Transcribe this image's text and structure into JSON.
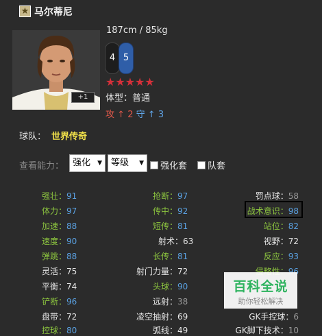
{
  "player": {
    "name": "马尔蒂尼",
    "size": "187cm / 85kg",
    "weak_foot_left": "4",
    "weak_foot_right": "5",
    "stars": "★★★★★",
    "body_type": "体型：普通",
    "card_plus": "+1",
    "workrate": {
      "atk_label": "攻",
      "atk_value": "2",
      "def_label": "守",
      "def_value": "3"
    }
  },
  "team": {
    "label": "球队：",
    "value": "世界传奇"
  },
  "filters": {
    "label": "查看能力：",
    "select1": "强化",
    "select2": "等级",
    "check1": "强化套",
    "check2": "队套"
  },
  "stats": {
    "col1": [
      {
        "label": "强壮：",
        "value": "91"
      },
      {
        "label": "体力：",
        "value": "97"
      },
      {
        "label": "加速：",
        "value": "88"
      },
      {
        "label": "速度：",
        "value": "90"
      },
      {
        "label": "弹跳：",
        "value": "88"
      },
      {
        "label": "灵活：",
        "value": "75"
      },
      {
        "label": "平衡：",
        "value": "74"
      },
      {
        "label": "铲断：",
        "value": "96"
      },
      {
        "label": "盘带：",
        "value": "72"
      },
      {
        "label": "控球：",
        "value": "80"
      }
    ],
    "col2": [
      {
        "label": "抢断：",
        "value": "97"
      },
      {
        "label": "传中：",
        "value": "92"
      },
      {
        "label": "短传：",
        "value": "81"
      },
      {
        "label": "射术：",
        "value": "63"
      },
      {
        "label": "长传：",
        "value": "81"
      },
      {
        "label": "射门力量：",
        "value": "72"
      },
      {
        "label": "头球：",
        "value": "90"
      },
      {
        "label": "远射：",
        "value": "38"
      },
      {
        "label": "凌空抽射：",
        "value": "69"
      },
      {
        "label": "弧线：",
        "value": "49"
      }
    ],
    "col3": [
      {
        "label": "罚点球：",
        "value": "58"
      },
      {
        "label": "战术意识：",
        "value": "98"
      },
      {
        "label": "站位：",
        "value": "82"
      },
      {
        "label": "视野：",
        "value": "72"
      },
      {
        "label": "反应：",
        "value": "93"
      },
      {
        "label": "侵略性：",
        "value": "96"
      },
      {
        "label": "",
        "value": ""
      },
      {
        "label": "",
        "value": ""
      },
      {
        "label": "GK手控球：",
        "value": "6"
      },
      {
        "label": "GK脚下技术：",
        "value": "10"
      }
    ]
  },
  "watermark": {
    "title": "百科全说",
    "subtitle": "助你轻松解决"
  }
}
